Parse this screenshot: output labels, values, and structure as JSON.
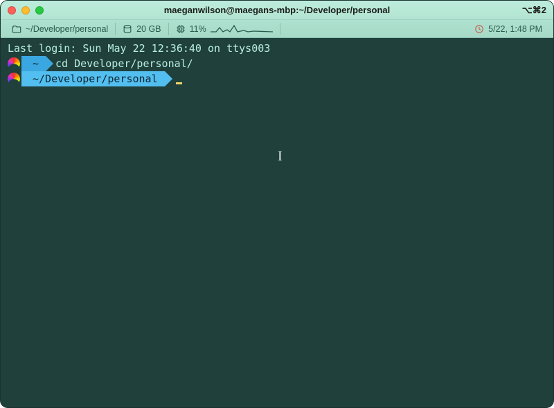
{
  "titlebar": {
    "title": "maeganwilson@maegans-mbp:~/Developer/personal",
    "shortcut": "⌥⌘2"
  },
  "statusbar": {
    "cwd": "~/Developer/personal",
    "disk": "20 GB",
    "cpu": "11%",
    "clock": "5/22, 1:48 PM"
  },
  "terminal": {
    "login_line": "Last login: Sun May 22 12:36:40 on ttys003",
    "line1": {
      "seg_home": "~",
      "command": "cd Developer/personal/"
    },
    "line2": {
      "seg_path": "~/Developer/personal"
    }
  }
}
